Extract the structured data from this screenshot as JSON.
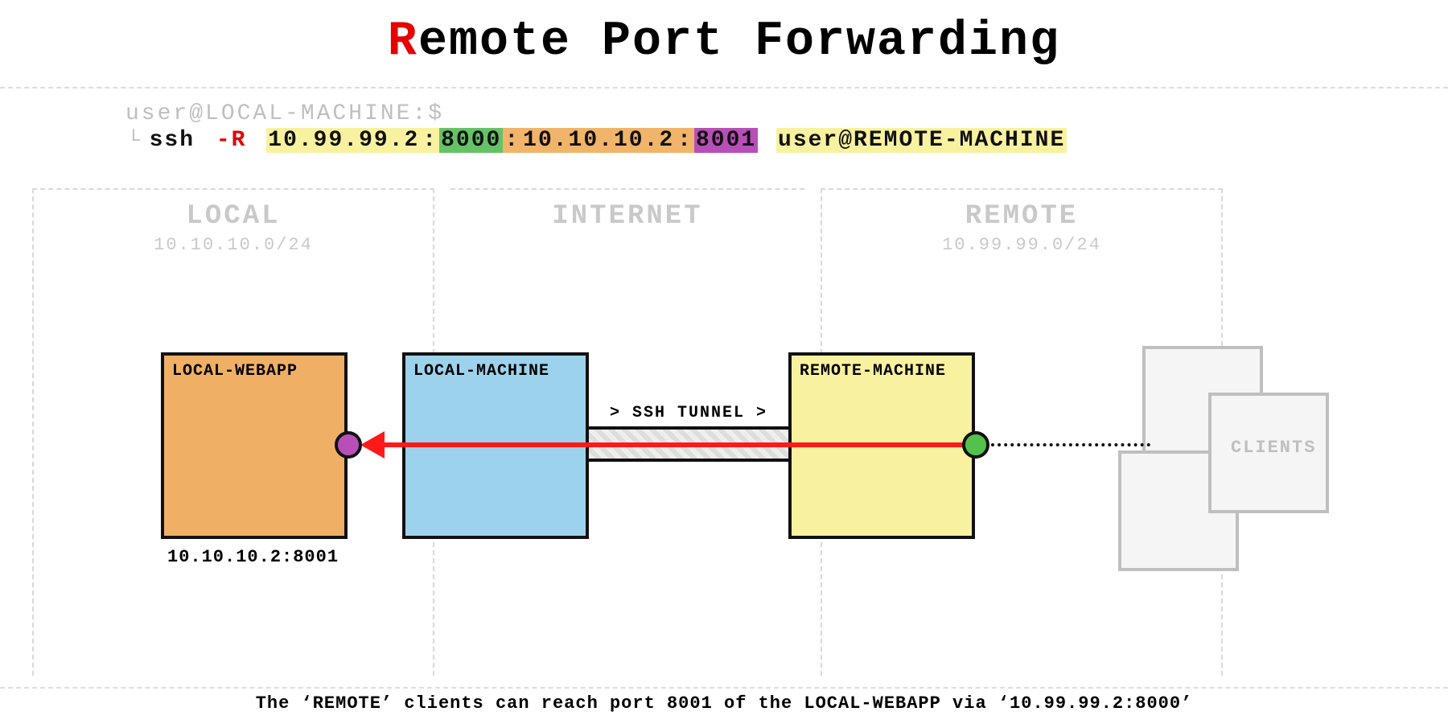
{
  "title": {
    "first_letter": "R",
    "rest": "emote Port Forwarding"
  },
  "prompt": "user@LOCAL-MACHINE:$",
  "command": {
    "caret": "└",
    "cmd": "ssh",
    "flag": "-R",
    "bind_addr": "10.99.99.2",
    "bind_port": "8000",
    "sep1": ":",
    "sep2": ":",
    "sep3": ":",
    "host_addr": "10.10.10.2",
    "host_port": "8001",
    "target": "user@REMOTE-MACHINE"
  },
  "zones": {
    "local": {
      "title": "LOCAL",
      "cidr": "10.10.10.0/24"
    },
    "internet": {
      "title": "INTERNET"
    },
    "remote": {
      "title": "REMOTE",
      "cidr": "10.99.99.0/24"
    }
  },
  "boxes": {
    "webapp": {
      "label": "LOCAL-WEBAPP",
      "addr": "10.10.10.2:8001"
    },
    "localm": {
      "label": "LOCAL-MACHINE"
    },
    "remotem": {
      "label": "REMOTE-MACHINE"
    }
  },
  "tunnel_label": "> SSH TUNNEL >",
  "clients_label": "CLIENTS",
  "caption": "The ‘REMOTE’ clients can reach port 8001 of the LOCAL-WEBAPP via ‘10.99.99.2:8000’",
  "colors": {
    "red": "#e60000",
    "yellow_hl": "#f8f2a0",
    "green_hl": "#66c266",
    "orange_hl": "#f0b46a",
    "purple_hl": "#b84fb8",
    "box_orange": "#efb066",
    "box_blue": "#9dd2ec",
    "box_yellow": "#f8f2a0",
    "port_green": "#52c24d",
    "arrow_red": "#ff1a1a",
    "grey": "#bfbfbf"
  }
}
